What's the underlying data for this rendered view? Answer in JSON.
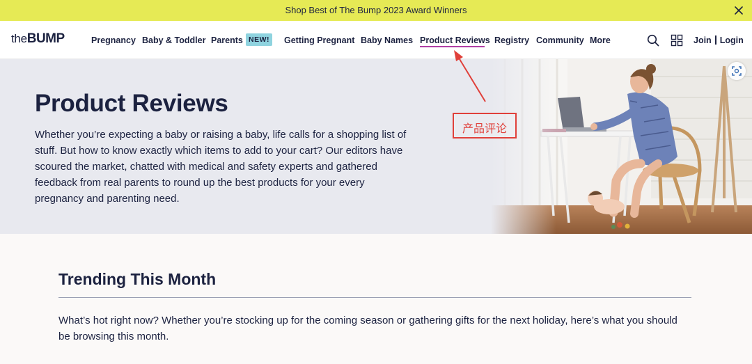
{
  "promo": {
    "text": "Shop Best of The Bump 2023 Award Winners",
    "close_icon": "close-icon"
  },
  "header": {
    "logo": {
      "the": "the",
      "bump": "BUMP"
    },
    "nav": [
      {
        "label": "Pregnancy"
      },
      {
        "label": "Baby & Toddler"
      },
      {
        "label": "Parents"
      },
      {
        "label": "Getting Pregnant"
      },
      {
        "label": "Baby Names"
      },
      {
        "label": "Product Reviews",
        "active": true
      },
      {
        "label": "Registry"
      },
      {
        "label": "Community"
      },
      {
        "label": "More"
      }
    ],
    "badge_new": "NEW!",
    "icons": [
      "search-icon",
      "grid-icon"
    ],
    "join": "Join",
    "login": "Login",
    "colors": {
      "active_underline": "#b03fa6",
      "badge_bg": "#8fd3df"
    }
  },
  "hero": {
    "title": "Product Reviews",
    "description": "Whether you’re expecting a baby or raising a baby, life calls for a shopping list of stuff. But how to know exactly which items to add to your cart? Our editors have scoured the market, chatted with medical and safety experts and gathered feedback from real parents to round up the best products for your every pregnancy and parenting need.",
    "scan_icon": "visual-search-icon"
  },
  "annotation": {
    "label": "产品评论",
    "color": "#e0403a"
  },
  "trending": {
    "title": "Trending This Month",
    "description": "What’s hot right now? Whether you’re stocking up for the coming season or gathering gifts for the next holiday, here’s what you should be browsing this month."
  }
}
